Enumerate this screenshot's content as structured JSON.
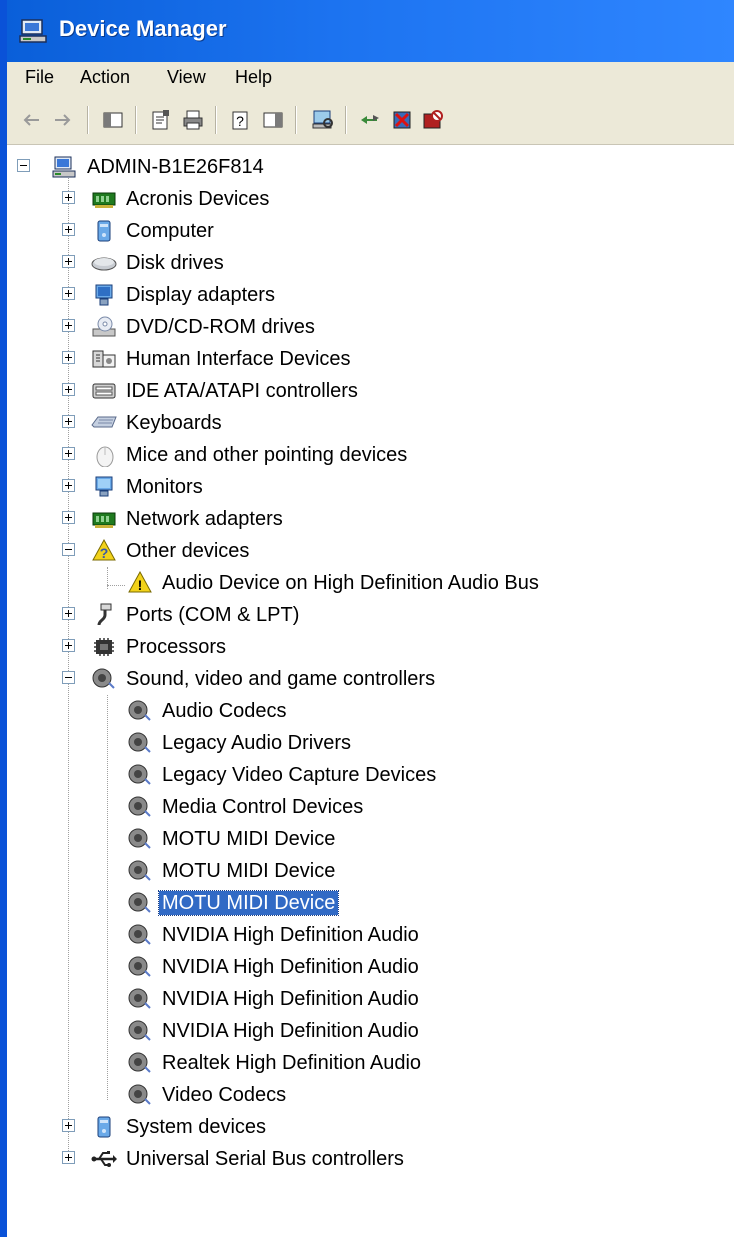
{
  "window": {
    "title": "Device Manager"
  },
  "menu": [
    "File",
    "Action",
    "View",
    "Help"
  ],
  "toolbar_icons": [
    "back-arrow-icon",
    "forward-arrow-icon",
    "show-hide-console-tree-icon",
    "properties-icon",
    "print-icon",
    "help-icon",
    "show-hide-action-pane-icon",
    "scan-hardware-icon",
    "update-driver-icon",
    "uninstall-icon",
    "disable-icon"
  ],
  "tree": {
    "root": "ADMIN-B1E26F814",
    "categories": [
      {
        "label": "Acronis Devices",
        "icon": "acronis-icon"
      },
      {
        "label": "Computer",
        "icon": "computer-icon"
      },
      {
        "label": "Disk drives",
        "icon": "disk-drive-icon"
      },
      {
        "label": "Display adapters",
        "icon": "display-adapter-icon"
      },
      {
        "label": "DVD/CD-ROM drives",
        "icon": "dvd-drive-icon"
      },
      {
        "label": "Human Interface Devices",
        "icon": "hid-icon"
      },
      {
        "label": "IDE ATA/ATAPI controllers",
        "icon": "ide-controller-icon"
      },
      {
        "label": "Keyboards",
        "icon": "keyboard-icon"
      },
      {
        "label": "Mice and other pointing devices",
        "icon": "mouse-icon"
      },
      {
        "label": "Monitors",
        "icon": "monitor-icon"
      },
      {
        "label": "Network adapters",
        "icon": "network-adapter-icon"
      }
    ],
    "other_devices": {
      "label": "Other devices",
      "children": [
        "Audio Device on High Definition Audio Bus"
      ]
    },
    "ports": "Ports (COM & LPT)",
    "processors": "Processors",
    "sound": {
      "label": "Sound, video and game controllers",
      "children": [
        "Audio Codecs",
        "Legacy Audio Drivers",
        "Legacy Video Capture Devices",
        "Media Control Devices",
        "MOTU MIDI Device",
        "MOTU MIDI Device",
        "MOTU MIDI Device",
        "NVIDIA High Definition Audio",
        "NVIDIA High Definition Audio",
        "NVIDIA High Definition Audio",
        "NVIDIA High Definition Audio",
        "Realtek High Definition Audio",
        "Video Codecs"
      ],
      "selected_index": 6
    },
    "system_devices": "System devices",
    "usb": "Universal Serial Bus controllers"
  }
}
